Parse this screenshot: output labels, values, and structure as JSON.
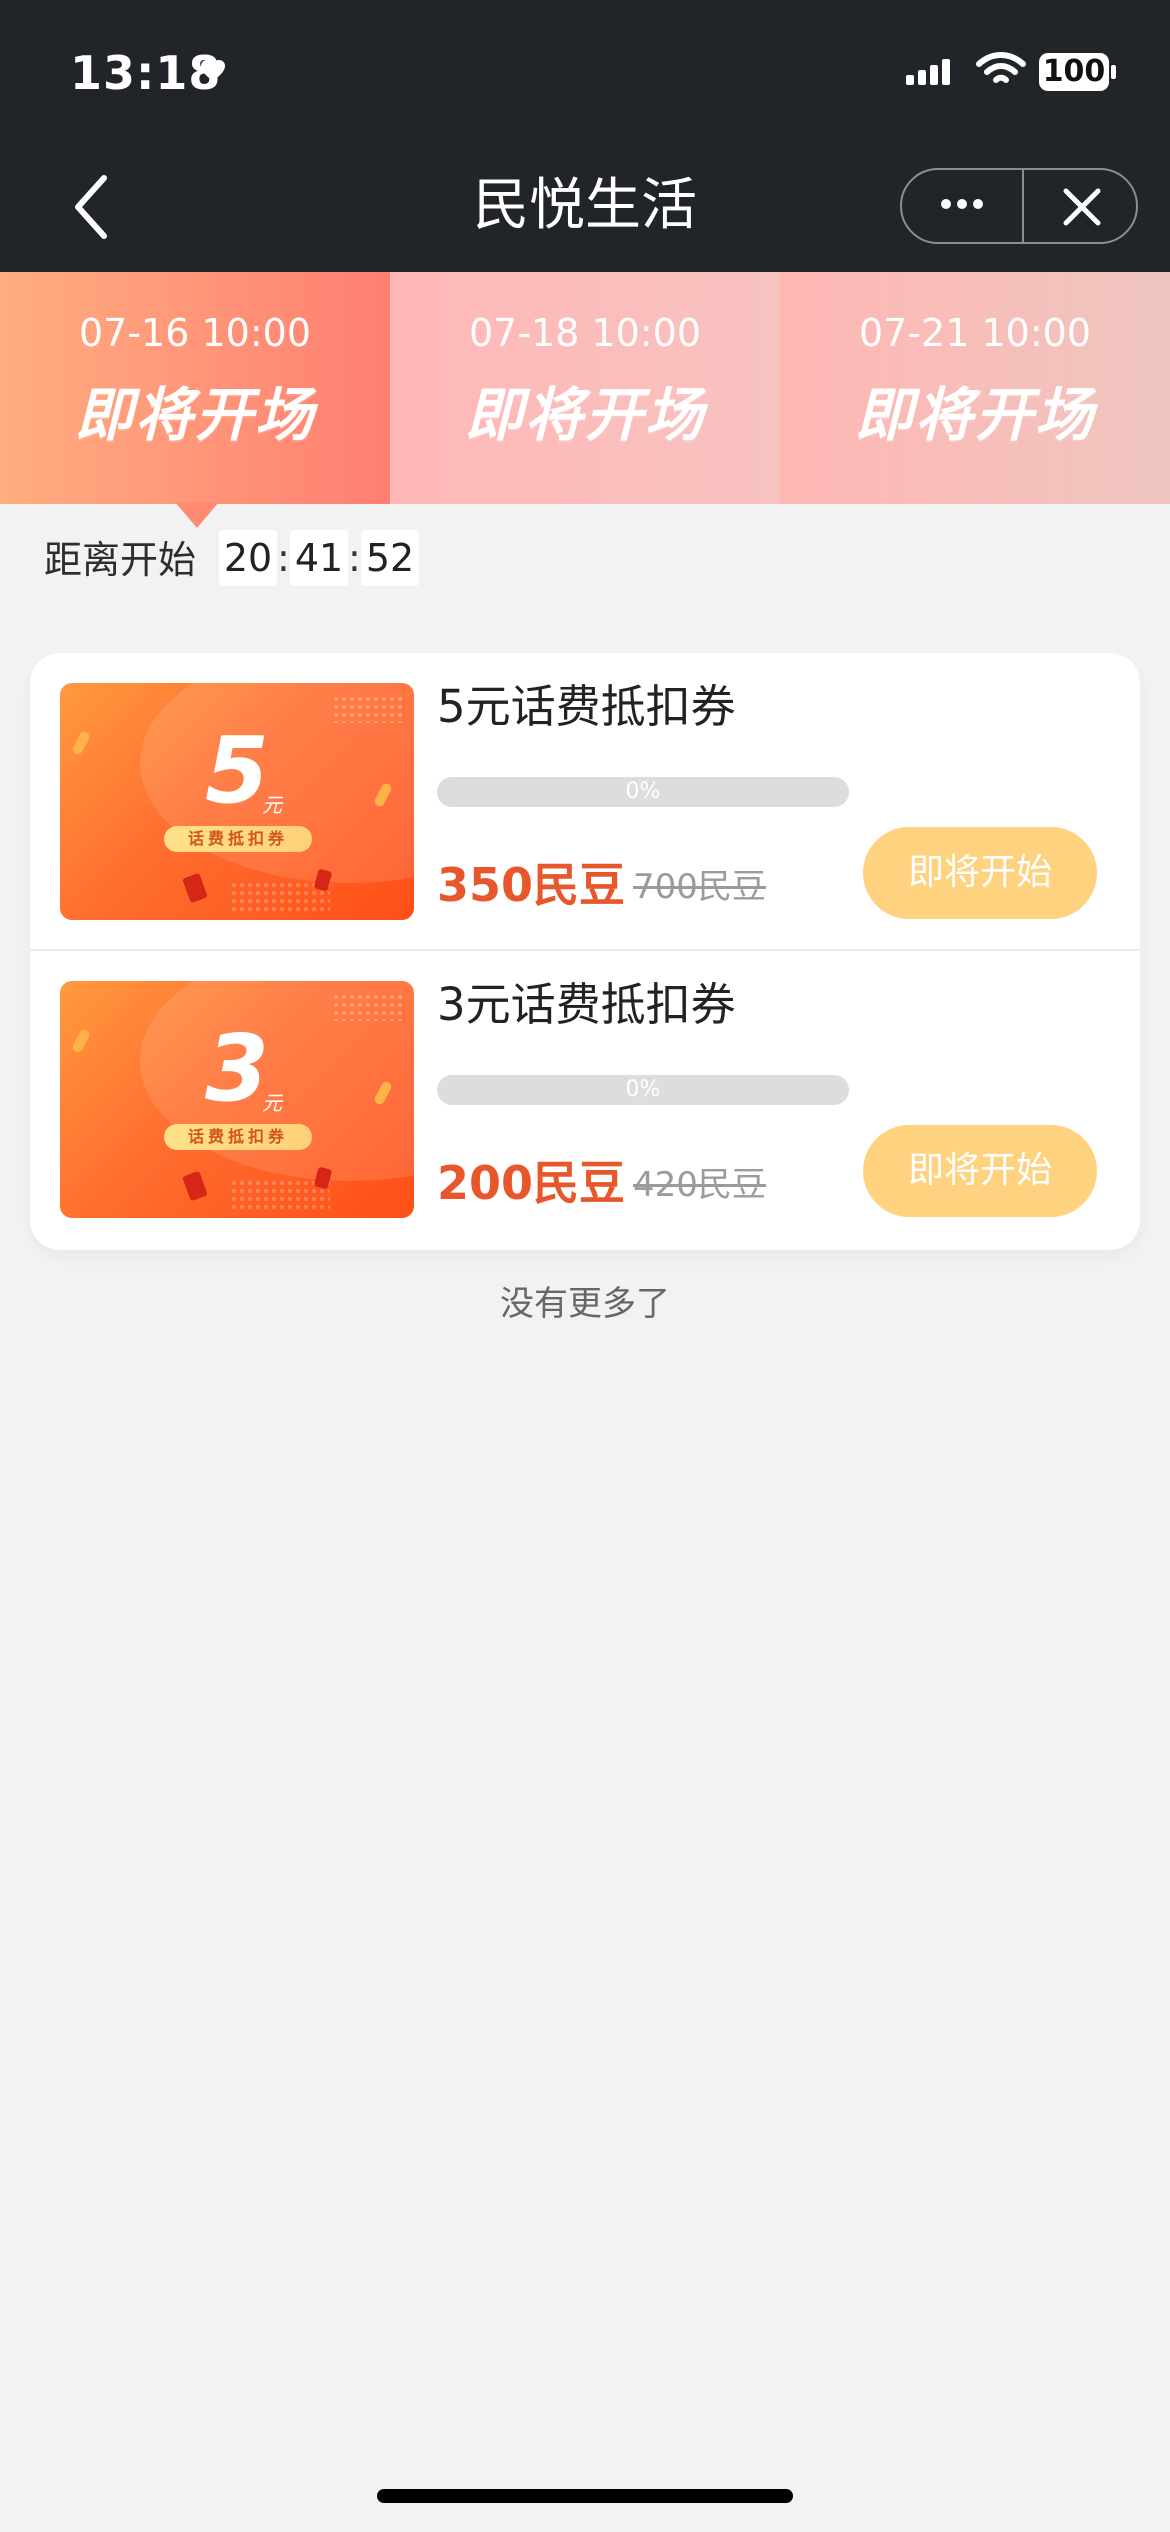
{
  "status_bar": {
    "time": "13:18",
    "battery": "100"
  },
  "nav": {
    "title": "民悦生活"
  },
  "tabs": [
    {
      "time": "07-16 10:00",
      "status": "即将开场"
    },
    {
      "time": "07-18 10:00",
      "status": "即将开场"
    },
    {
      "time": "07-21 10:00",
      "status": "即将开场"
    }
  ],
  "countdown": {
    "label": "距离开始",
    "hours": "20",
    "minutes": "41",
    "seconds": "52"
  },
  "items": [
    {
      "thumb_value": "5",
      "thumb_unit": "元",
      "thumb_badge": "话费抵扣券",
      "title": "5元话费抵扣券",
      "progress_text": "0%",
      "progress": 0,
      "price": "350民豆",
      "old_price": "700民豆",
      "button": "即将开始"
    },
    {
      "thumb_value": "3",
      "thumb_unit": "元",
      "thumb_badge": "话费抵扣券",
      "title": "3元话费抵扣券",
      "progress_text": "0%",
      "progress": 0,
      "price": "200民豆",
      "old_price": "420民豆",
      "button": "即将开始"
    }
  ],
  "footer": {
    "text": "没有更多了"
  },
  "colors": {
    "accent": "#e8572c",
    "button": "#ffd27f",
    "topbar": "#212428"
  }
}
